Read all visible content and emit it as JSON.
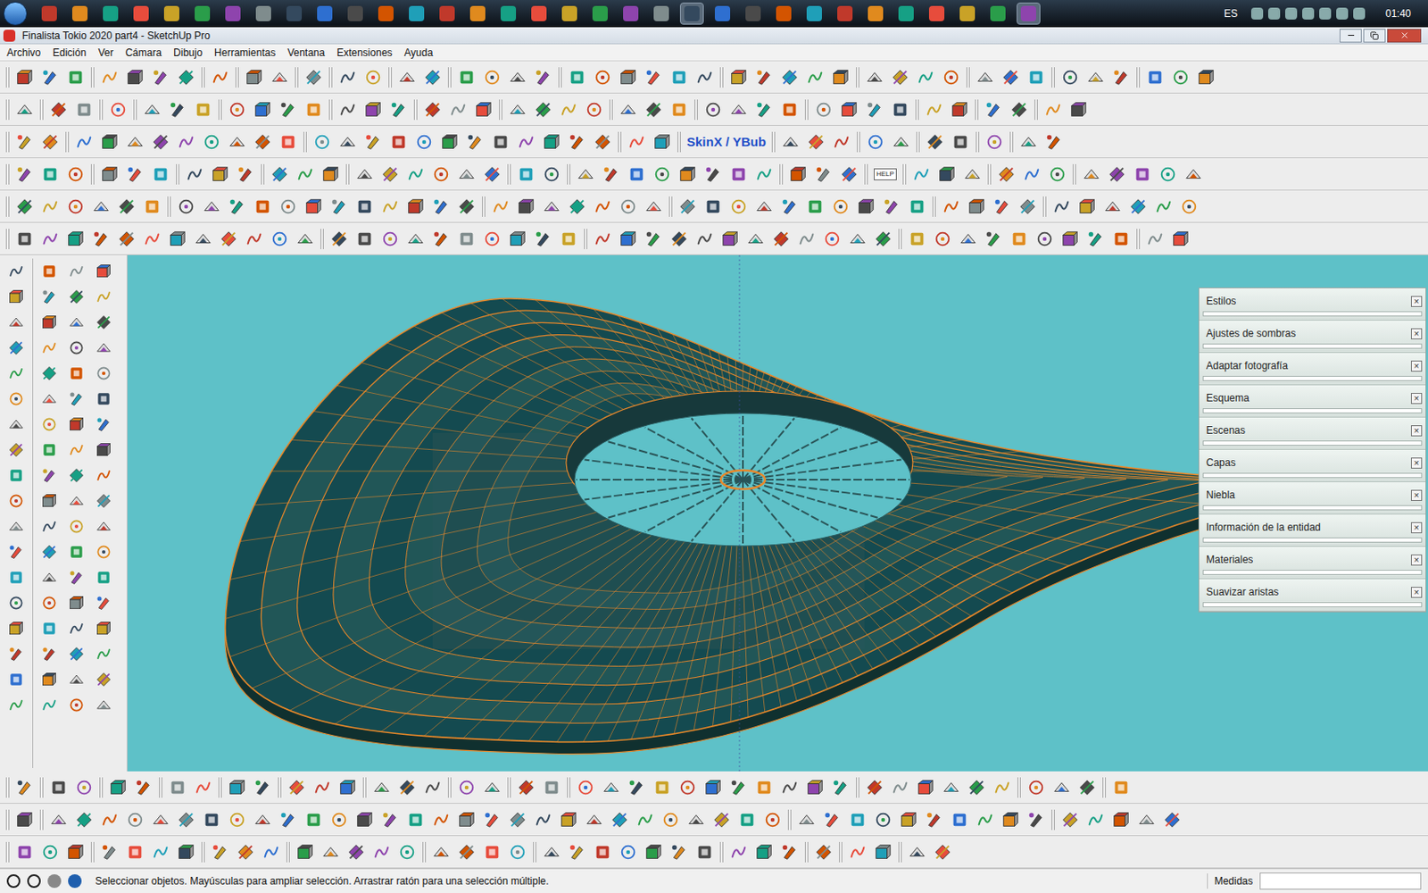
{
  "taskbar": {
    "language": "ES",
    "clock": "01:40"
  },
  "window": {
    "title": "Finalista Tokio 2020 part4 - SketchUp Pro"
  },
  "menu": [
    "Archivo",
    "Edición",
    "Ver",
    "Cámara",
    "Dibujo",
    "Herramientas",
    "Ventana",
    "Extensiones",
    "Ayuda"
  ],
  "toolbar_labels": {
    "skinx": "SkinX / YBub",
    "help": "HELP"
  },
  "tray": {
    "close": "×",
    "panels": [
      {
        "title": "Estilos",
        "expanded": false
      },
      {
        "title": "Ajustes de sombras",
        "expanded": false
      },
      {
        "title": "Adaptar fotografía",
        "expanded": false
      },
      {
        "title": "Esquema",
        "expanded": false
      },
      {
        "title": "Escenas",
        "expanded": false
      },
      {
        "title": "Capas",
        "expanded": false
      },
      {
        "title": "Niebla",
        "expanded": false
      },
      {
        "title": "Información de la entidad",
        "expanded": false
      },
      {
        "title": "Materiales",
        "expanded": false
      },
      {
        "title": "Suavizar aristas",
        "expanded": false
      }
    ]
  },
  "status_bar": {
    "hint": "Seleccionar objetos. Mayúsculas para ampliar selección. Arrastrar ratón para una selección múltiple.",
    "measurements_label": "Medidas"
  }
}
